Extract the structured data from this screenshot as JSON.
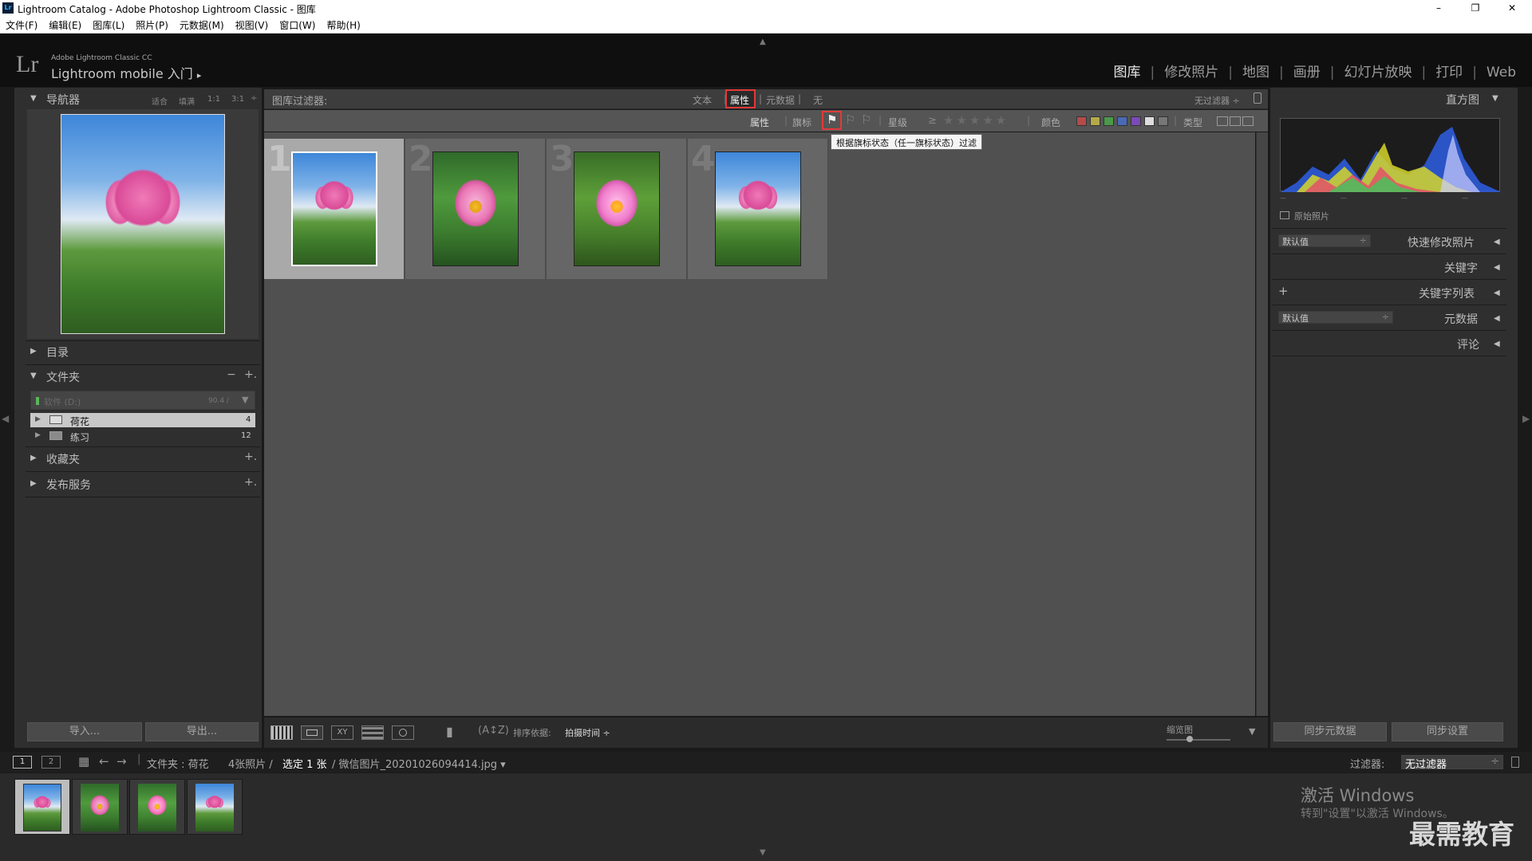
{
  "window": {
    "app_logo": "Lr",
    "title": "Lightroom Catalog - Adobe Photoshop Lightroom Classic - 图库",
    "min": "–",
    "max": "❐",
    "close": "✕"
  },
  "menu": [
    "文件(F)",
    "编辑(E)",
    "图库(L)",
    "照片(P)",
    "元数据(M)",
    "视图(V)",
    "窗口(W)",
    "帮助(H)"
  ],
  "identity": {
    "logo": "Lr",
    "line1": "Adobe Lightroom Classic CC",
    "line2": "Lightroom mobile 入门",
    "arrow": "▸"
  },
  "modules": [
    "图库",
    "修改照片",
    "地图",
    "画册",
    "幻灯片放映",
    "打印",
    "Web"
  ],
  "left": {
    "navigator": {
      "title": "导航器",
      "zoom": [
        "适合",
        "填满",
        "1:1",
        "3:1"
      ]
    },
    "catalog": "目录",
    "folders": {
      "title": "文件夹",
      "minus": "−",
      "plus": "+.",
      "volume": {
        "name": "软件 (D:)",
        "size": "90.4 /"
      },
      "items": [
        {
          "name": "荷花",
          "count": "4"
        },
        {
          "name": "练习",
          "count": "12"
        }
      ]
    },
    "collections": "收藏夹",
    "publish": "发布服务",
    "import": "导入...",
    "export": "导出..."
  },
  "filter": {
    "label": "图库过滤器:",
    "tabs": [
      "文本",
      "属性",
      "元数据",
      "无"
    ],
    "preset": "无过滤器 ÷",
    "attr_label": "属性",
    "flag_label": "旗标",
    "rating_label": "星级",
    "rating_op": "≥",
    "stars": "★★★★★",
    "color_label": "颜色",
    "type_label": "类型",
    "tooltip": "根据旗标状态（任一旗标状态）过滤"
  },
  "colors": {
    "label_red": "#b54a4a",
    "label_yellow": "#b5a94a",
    "label_green": "#4a9a4a",
    "label_blue": "#4a6ab5",
    "label_purple": "#7a4ab5",
    "highlight": "#e23a3a"
  },
  "grid": {
    "numbers": [
      "1",
      "2",
      "3",
      "4"
    ]
  },
  "toolbar": {
    "sort_label": "排序依据:",
    "sort_value": "拍摄时间 ÷",
    "thumb_label": "缩览图"
  },
  "right": {
    "histogram": "直方图",
    "original": "原始照片",
    "quick_preset": "默认值",
    "quick_develop": "快速修改照片",
    "keywording": "关键字",
    "keyword_list": "关键字列表",
    "keyword_plus": "+",
    "meta_preset": "默认值",
    "metadata": "元数据",
    "comments": "评论",
    "sync_meta": "同步元数据",
    "sync_settings": "同步设置"
  },
  "filmbar": {
    "monitor1": "1",
    "monitor2": "2",
    "path_prefix": "文件夹 : 荷花",
    "count": "4张照片 /",
    "selected": "选定 1 张",
    "file": "/ 微信图片_20201026094414.jpg ▾",
    "filter_label": "过滤器:",
    "filter_value": "无过滤器"
  },
  "watermark": {
    "activate": "激活 Windows",
    "hint": "转到\"设置\"以激活 Windows。",
    "brand": "最需教育"
  }
}
